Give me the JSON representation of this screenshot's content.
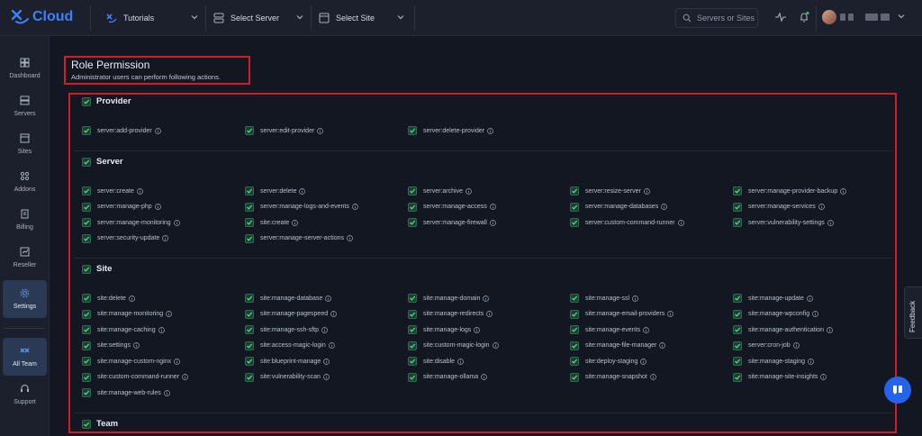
{
  "brand": {
    "name": "Cloud"
  },
  "topbar": {
    "tutorials": "Tutorials",
    "select_server": "Select Server",
    "select_site": "Select Site",
    "search_placeholder": "Servers or Sites"
  },
  "sidebar": {
    "items": [
      {
        "label": "Dashboard",
        "icon": "grid-icon"
      },
      {
        "label": "Servers",
        "icon": "server-icon"
      },
      {
        "label": "Sites",
        "icon": "browser-icon"
      },
      {
        "label": "Addons",
        "icon": "addons-icon"
      },
      {
        "label": "Billing",
        "icon": "billing-icon"
      },
      {
        "label": "Reseller",
        "icon": "reseller-icon"
      },
      {
        "label": "Settings",
        "icon": "gear-icon",
        "active": true
      },
      {
        "label": "All Team",
        "icon": "team-icon",
        "active": true
      },
      {
        "label": "Support",
        "icon": "headset-icon"
      }
    ]
  },
  "page": {
    "title": "Role Permission",
    "subtitle": "Administrator users can perform following actions."
  },
  "sections": [
    {
      "title": "Provider",
      "permissions": [
        "server:add-provider",
        "server:edit-provider",
        "server:delete-provider"
      ]
    },
    {
      "title": "Server",
      "permissions": [
        "server:create",
        "server:delete",
        "server:archive",
        "server:resize-server",
        "server:manage-provider-backup",
        "server:manage-php",
        "server:manage-logs-and-events",
        "server:manage-access",
        "server:manage-databases",
        "server:manage-services",
        "server:manage-monitoring",
        "site:create",
        "server:manage-firewall",
        "server:custom-command-runner",
        "server:vulnerability-settings",
        "server:security-update",
        "server:manage-server-actions"
      ]
    },
    {
      "title": "Site",
      "permissions": [
        "site:delete",
        "site:manage-database",
        "site:manage-domain",
        "site:manage-ssl",
        "site:manage-update",
        "site:manage-monitoring",
        "site:manage-pagespeed",
        "site:manage-redirects",
        "site:manage-email-providers",
        "site:manage-wpconfig",
        "site:manage-caching",
        "site:manage-ssh-sftp",
        "site:manage-logs",
        "site:manage-events",
        "site:manage-authentication",
        "site:settings",
        "site:access-magic-login",
        "site:custom-magic-login",
        "site:manage-file-manager",
        "server:cron-job",
        "site:manage-custom-nginx",
        "site:blueprint-manage",
        "site:disable",
        "site:deploy-staging",
        "site:manage-staging",
        "site:custom-command-runner",
        "site:vulnerability-scan",
        "site:manage-ollama",
        "site:manage-snapshot",
        "site:manage-site-insights",
        "site:manage-web-rules"
      ]
    },
    {
      "title": "Team",
      "permissions": []
    }
  ],
  "feedback": {
    "label": "Feedback"
  },
  "colors": {
    "accent": "#3b82f6",
    "highlight_border": "#d21c2a",
    "checkbox": "#22c55e"
  }
}
